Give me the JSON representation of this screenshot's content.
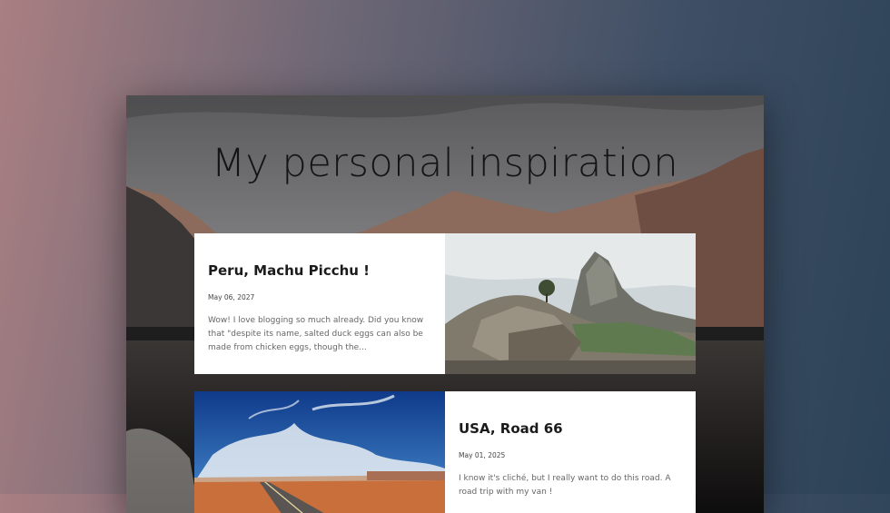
{
  "hero": {
    "title": "My personal inspiration"
  },
  "posts": [
    {
      "title": "Peru, Machu Picchu !",
      "date": "May 06, 2027",
      "excerpt": "Wow! I love blogging so much already. Did you know that \"despite its name, salted duck eggs can also be made from chicken eggs, though the..."
    },
    {
      "title": "USA, Road 66",
      "date": "May 01, 2025",
      "excerpt": "I know it's cliché, but I really want to do this road. A road trip with my van !"
    }
  ],
  "colors": {
    "background_left": "#a97f82",
    "background_right": "#2c4257",
    "card": "#ffffff",
    "title": "#141414"
  }
}
